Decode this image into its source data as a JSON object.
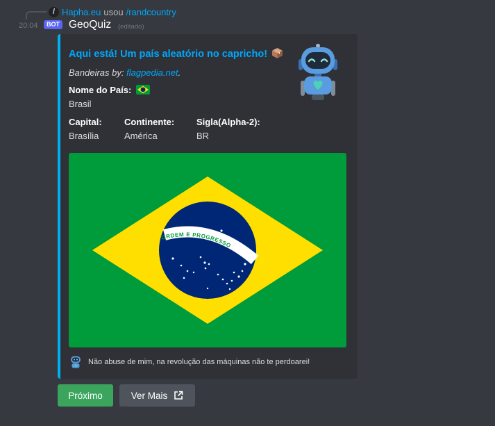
{
  "reply": {
    "user": "Hapha.eu",
    "used_text": "usou",
    "command": "/randcountry",
    "slash_glyph": "/"
  },
  "message": {
    "timestamp": "20:04",
    "bot_tag": "BOT",
    "username": "GeoQuiz",
    "edited": "(editado)"
  },
  "embed": {
    "accent_color": "#00b0f4",
    "title": "Aqui está! Um país aleatório no capricho!",
    "title_icon": "package-icon",
    "description_prefix": "Bandeiras by: ",
    "description_link": "flagpedia.net",
    "description_suffix": ".",
    "fields": {
      "country_name": {
        "name": "Nome do País:",
        "value": "Brasil",
        "flag_icon": "brazil-flag-icon"
      },
      "capital": {
        "name": "Capital:",
        "value": "Brasília"
      },
      "continent": {
        "name": "Continente:",
        "value": "América"
      },
      "code": {
        "name": "Sigla(Alpha-2):",
        "value": "BR"
      }
    },
    "flag_motto": "ORDEM E PROGRESSO",
    "footer_text": "Não abuse de mim, na revolução das máquinas não te perdoarei!",
    "thumbnail_icon": "robot-icon"
  },
  "buttons": {
    "next_label": "Próximo",
    "more_label": "Ver Mais",
    "next_color": "#3ba55d",
    "more_color": "#4f545c"
  }
}
